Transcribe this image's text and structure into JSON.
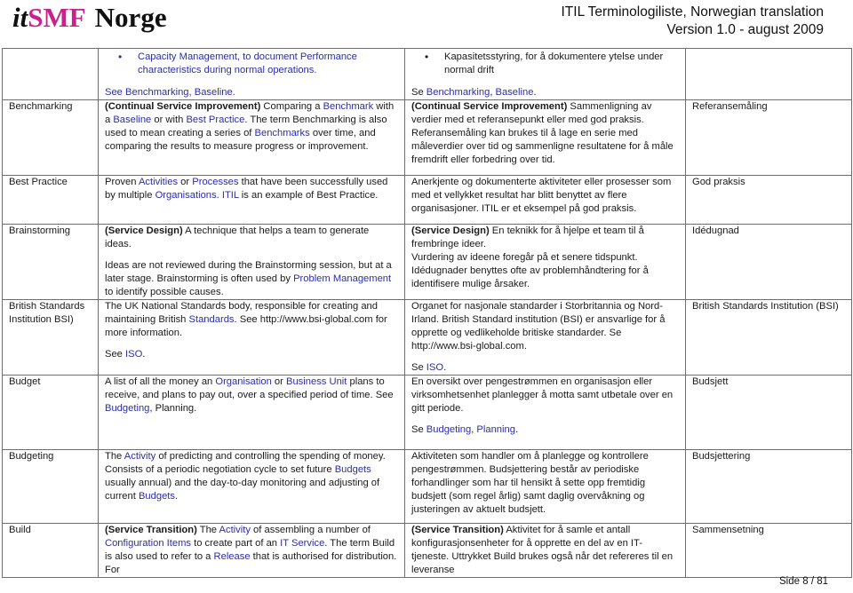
{
  "header": {
    "logo": {
      "it": "it",
      "smf": "SMF",
      "norge": "Norge"
    },
    "title_line1": "ITIL Terminologiliste, Norwegian translation",
    "title_line2": "Version 1.0 - august 2009"
  },
  "colors": {
    "brand_magenta": "#c8238c",
    "link_blue": "#2b2ea8",
    "border": "#6e6e6e"
  },
  "rows": [
    {
      "term": "",
      "en": {
        "bullet": "Capacity Management, to document Performance characteristics during normal operations.",
        "see_prefix": "See ",
        "see_links": [
          "Benchmarking",
          "Baseline"
        ]
      },
      "no": {
        "bullet": "Kapasitetsstyring, for å dokumentere ytelse under normal drift",
        "see_prefix": "Se ",
        "see_links": [
          "Benchmarking",
          "Baseline"
        ]
      },
      "translation": ""
    },
    {
      "term": "Benchmarking",
      "en": {
        "phase": "(Continual Service Improvement)",
        "t1": " Comparing a ",
        "l1": "Benchmark",
        "t2": " with a ",
        "l2": "Baseline",
        "t3": " or with ",
        "l3": "Best Practice",
        "t4": ". The term Benchmarking is also used to mean creating a series of ",
        "l4": "Benchmarks",
        "t5": " over time, and comparing the results to measure progress or improvement."
      },
      "no": {
        "phase": "(Continual Service Improvement)",
        "text": " Sammenligning av verdier med et referansepunkt eller med god praksis. Referansemåling kan brukes til å lage en serie med måleverdier over tid og sammenligne resultatene for å måle fremdrift eller forbedring over tid."
      },
      "translation": "Referansemåling"
    },
    {
      "term": "Best Practice",
      "en": {
        "t1": "Proven ",
        "l1": "Activities",
        "t2": " or ",
        "l2": "Processes",
        "t3": " that have been successfully used by multiple ",
        "l3": "Organisations",
        "t4": ". ",
        "l4": "ITIL",
        "t5": " is an example of Best Practice."
      },
      "no": {
        "text": "Anerkjente og dokumenterte aktiviteter eller prosesser som med et vellykket resultat har blitt benyttet av flere organisasjoner. ITIL er et eksempel på god praksis."
      },
      "translation": "God praksis"
    },
    {
      "term": "Brainstorming",
      "en": {
        "phase": "(Service Design)",
        "p1": " A technique that helps a team to generate ideas.",
        "p2a": "Ideas are not reviewed during the Brainstorming session, but at a later stage. Brainstorming is often used by ",
        "l1": "Problem Management",
        "p2b": " to identify possible causes."
      },
      "no": {
        "phase": "(Service Design)",
        "p1": " En teknikk for å hjelpe et team til å frembringe ideer.",
        "p2": "Vurdering av ideene foregår på et senere tidspunkt.",
        "p3": "Idédugnader benyttes ofte av problemhåndtering for å identifisere mulige årsaker."
      },
      "translation": "Idédugnad"
    },
    {
      "term": "British Standards Institution BSI)",
      "en": {
        "t1": "The UK National Standards body, responsible for creating and maintaining British ",
        "l1": "Standards",
        "t2": ". See http://www.bsi-global.com for more information.",
        "see_prefix": "See ",
        "see_link": "ISO",
        "see_suffix": "."
      },
      "no": {
        "text": "Organet for nasjonale standarder i Storbritannia og Nord-Irland. British Standard institution (BSI) er ansvarlige for å opprette og vedlikeholde britiske standarder. Se http://www.bsi-global.com.",
        "see_prefix": "Se ",
        "see_link": "ISO",
        "see_suffix": "."
      },
      "translation": "British Standards Institution (BSI)"
    },
    {
      "term": "Budget",
      "en": {
        "t1": "A list of all the money an ",
        "l1": "Organisation",
        "t2": " or ",
        "l2": "Business Unit",
        "t3": " plans to receive, and plans to pay out, over a specified period of time. See ",
        "l3": "Budgeting",
        "t4": ", Planning."
      },
      "no": {
        "text": "En oversikt over pengestrømmen en organisasjon eller virksomhetsenhet planlegger å motta samt utbetale over en gitt periode.",
        "see_prefix": "Se ",
        "see_links": [
          "Budgeting",
          "Planning"
        ]
      },
      "translation": "Budsjett"
    },
    {
      "term": "Budgeting",
      "en": {
        "t1": "The ",
        "l1": "Activity",
        "t2": " of predicting and controlling the spending of money. Consists of a periodic negotiation cycle to set future ",
        "l2": "Budgets",
        "t3": " usually annual) and the day-to-day monitoring and adjusting of current ",
        "l3": "Budgets",
        "t4": "."
      },
      "no": {
        "text": "Aktiviteten som handler om å planlegge og kontrollere pengestrømmen. Budsjettering består av periodiske forhandlinger som har til hensikt å sette opp fremtidig budsjett (som regel årlig) samt daglig overvåkning og justeringen av aktuelt budsjett."
      },
      "translation": "Budsjettering"
    },
    {
      "term": "Build",
      "en": {
        "phase": "(Service Transition)",
        "t1": " The ",
        "l1": "Activity",
        "t2": " of assembling a number of ",
        "l2": "Configuration Items",
        "t3": " to create part of an ",
        "l3": "IT Service",
        "t4": ". The term Build is also used to refer to a ",
        "l4": "Release",
        "t5": " that is authorised for distribution. For"
      },
      "no": {
        "phase": "(Service Transition)",
        "text": " Aktivitet for å samle et antall konfigurasjonsenheter for å opprette en del av en IT-tjeneste. Uttrykket Build brukes også når det refereres til en leveranse"
      },
      "translation": "Sammensetning"
    }
  ],
  "footer": {
    "page_label": "Side 8 / 81"
  }
}
